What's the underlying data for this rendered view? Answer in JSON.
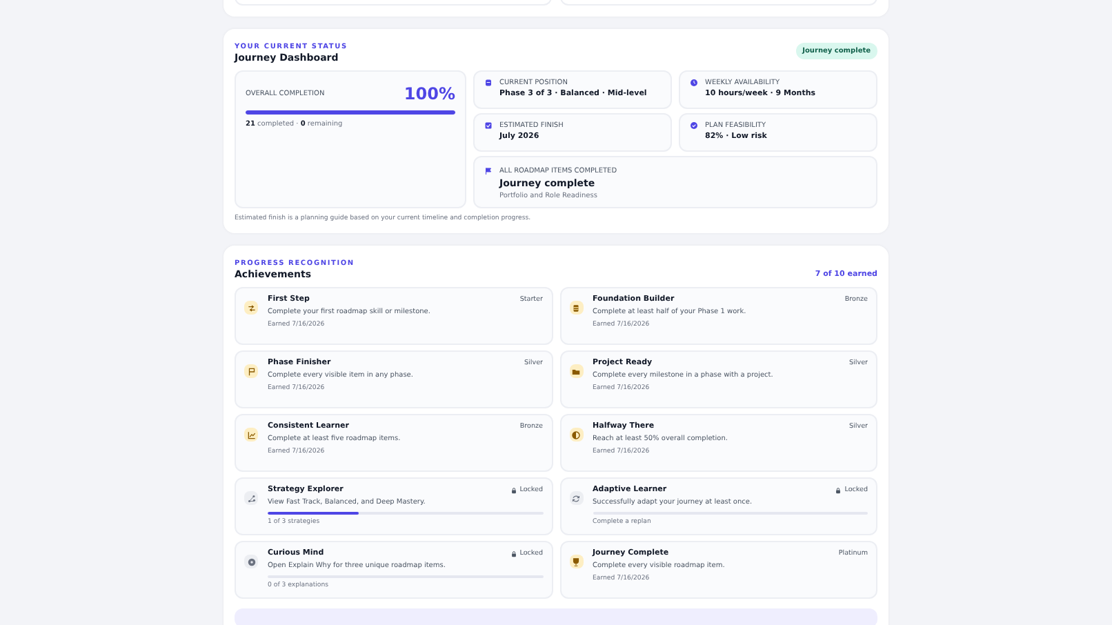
{
  "status": {
    "eyebrow": "YOUR CURRENT STATUS",
    "title": "Journey Dashboard",
    "badge": "Journey complete",
    "completion": {
      "label": "OVERALL COMPLETION",
      "percent": "100%",
      "level": 1.0,
      "completed": "21",
      "completed_label": "completed",
      "separator": "·",
      "remaining": "0",
      "remaining_label": "remaining"
    },
    "facts": [
      {
        "label": "CURRENT POSITION",
        "value": "Phase 3 of 3 · Balanced · Mid-level"
      },
      {
        "label": "WEEKLY AVAILABILITY",
        "value": "10 hours/week · 9 Months"
      },
      {
        "label": "ESTIMATED FINISH",
        "value": "July 2026"
      },
      {
        "label": "PLAN FEASIBILITY",
        "value": "82% · Low risk"
      }
    ],
    "summary": {
      "label": "ALL ROADMAP ITEMS COMPLETED",
      "value": "Journey complete",
      "detail": "Portfolio and Role Readiness"
    },
    "note": "Estimated finish is a planning guide based on your current timeline and completion progress."
  },
  "achievements": {
    "eyebrow": "PROGRESS RECOGNITION",
    "title": "Achievements",
    "count": "7 of 10 earned",
    "items": [
      {
        "title": "First Step",
        "tier": "Starter",
        "locked": false,
        "description": "Complete your first roadmap skill or milestone.",
        "footer": "Earned 7/16/2026"
      },
      {
        "title": "Foundation Builder",
        "tier": "Bronze",
        "locked": false,
        "description": "Complete at least half of your Phase 1 work.",
        "footer": "Earned 7/16/2026"
      },
      {
        "title": "Phase Finisher",
        "tier": "Silver",
        "locked": false,
        "description": "Complete every visible item in any phase.",
        "footer": "Earned 7/16/2026"
      },
      {
        "title": "Project Ready",
        "tier": "Silver",
        "locked": false,
        "description": "Complete every milestone in a phase with a project.",
        "footer": "Earned 7/16/2026"
      },
      {
        "title": "Consistent Learner",
        "tier": "Bronze",
        "locked": false,
        "description": "Complete at least five roadmap items.",
        "footer": "Earned 7/16/2026"
      },
      {
        "title": "Halfway There",
        "tier": "Silver",
        "locked": false,
        "description": "Reach at least 50% overall completion.",
        "footer": "Earned 7/16/2026"
      },
      {
        "title": "Strategy Explorer",
        "tier": "Locked",
        "locked": true,
        "level": 0.33,
        "description": "View Fast Track, Balanced, and Deep Mastery.",
        "footer": "1 of 3 strategies"
      },
      {
        "title": "Adaptive Learner",
        "tier": "Locked",
        "locked": true,
        "level": 0,
        "description": "Successfully adapt your journey at least once.",
        "footer": "Complete a replan"
      },
      {
        "title": "Curious Mind",
        "tier": "Locked",
        "locked": true,
        "level": 0,
        "description": "Open Explain Why for three unique roadmap items.",
        "footer": "0 of 3 explanations"
      },
      {
        "title": "Journey Complete",
        "tier": "Platinum",
        "locked": false,
        "description": "Complete every visible roadmap item.",
        "footer": "Earned 7/16/2026"
      }
    ]
  }
}
